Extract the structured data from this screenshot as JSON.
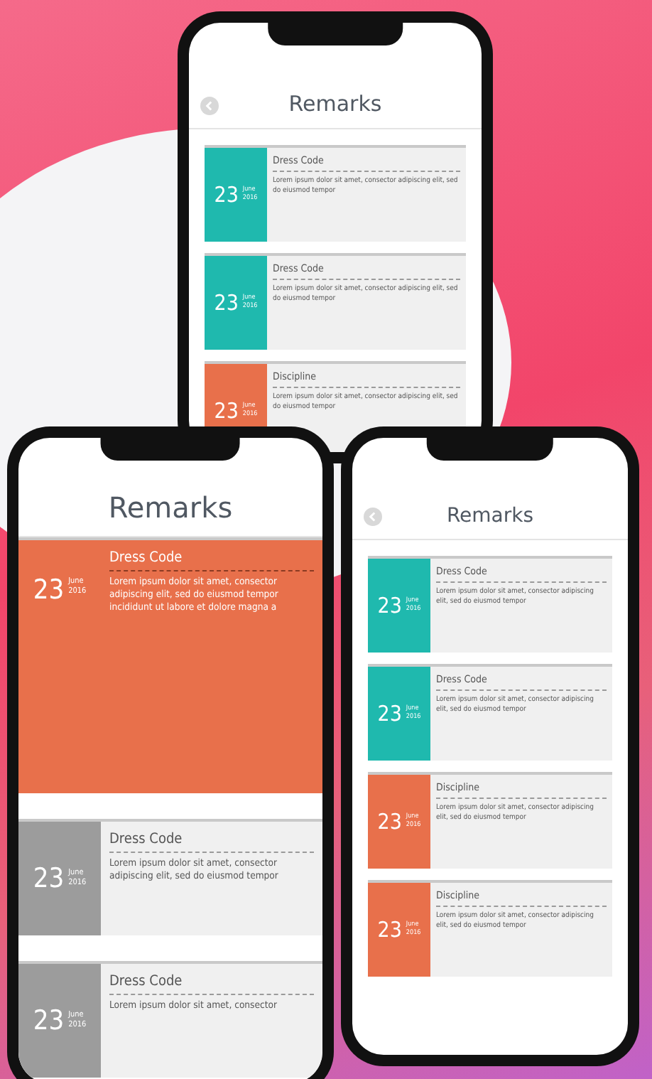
{
  "phones": [
    {
      "title": "Remarks",
      "back_button": true,
      "cards": [
        {
          "title": "Dress Code",
          "day": "23",
          "month": "June",
          "year": "2016",
          "text": "Lorem ipsum dolor sit amet, consector adipiscing elit, sed do eiusmod tempor",
          "color": "#1fb9ae",
          "expanded": false
        },
        {
          "title": "Dress Code",
          "day": "23",
          "month": "June",
          "year": "2016",
          "text": "Lorem ipsum dolor sit amet, consector adipiscing elit, sed do eiusmod tempor",
          "color": "#1fb9ae",
          "expanded": false
        },
        {
          "title": "Discipline",
          "day": "23",
          "month": "June",
          "year": "2016",
          "text": "Lorem ipsum dolor sit amet, consector adipiscing elit, sed do eiusmod tempor",
          "color": "#e8704b",
          "expanded": false
        }
      ]
    },
    {
      "title": "Remarks",
      "back_button": false,
      "cards": [
        {
          "title": "Dress Code",
          "day": "23",
          "month": "June",
          "year": "2016",
          "text": "Lorem ipsum dolor sit amet, consector adipiscing elit, sed do eiusmod tempor incididunt ut labore et dolore magna a",
          "color": "#e8704b",
          "expanded": true
        },
        {
          "title": "Dress Code",
          "day": "23",
          "month": "June",
          "year": "2016",
          "text": "Lorem ipsum dolor sit amet, consector adipiscing elit, sed do eiusmod tempor",
          "color": "#9c9c9c",
          "expanded": false
        },
        {
          "title": "Dress Code",
          "day": "23",
          "month": "June",
          "year": "2016",
          "text": "Lorem ipsum dolor sit amet, consector",
          "color": "#9c9c9c",
          "expanded": false
        }
      ]
    },
    {
      "title": "Remarks",
      "back_button": true,
      "cards": [
        {
          "title": "Dress Code",
          "day": "23",
          "month": "June",
          "year": "2016",
          "text": "Lorem ipsum dolor sit amet, consector adipiscing elit, sed do eiusmod tempor",
          "color": "#1fb9ae",
          "expanded": false
        },
        {
          "title": "Dress Code",
          "day": "23",
          "month": "June",
          "year": "2016",
          "text": "Lorem ipsum dolor sit amet, consector adipiscing elit, sed do eiusmod tempor",
          "color": "#1fb9ae",
          "expanded": false
        },
        {
          "title": "Discipline",
          "day": "23",
          "month": "June",
          "year": "2016",
          "text": "Lorem ipsum dolor sit amet, consector adipiscing elit, sed do eiusmod tempor",
          "color": "#e8704b",
          "expanded": false
        },
        {
          "title": "Discipline",
          "day": "23",
          "month": "June",
          "year": "2016",
          "text": "Lorem ipsum dolor sit amet, consector adipiscing elit, sed do eiusmod tempor",
          "color": "#e8704b",
          "expanded": false
        }
      ]
    }
  ]
}
